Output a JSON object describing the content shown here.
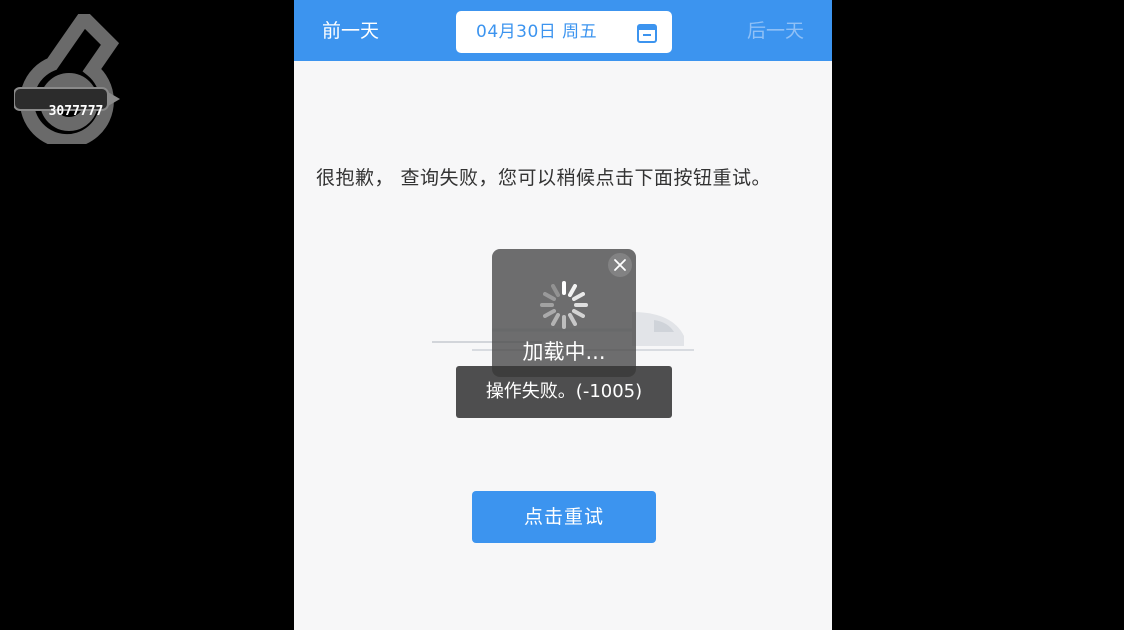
{
  "watermark": {
    "text": "3077777"
  },
  "header": {
    "prev_label": "前一天",
    "date_label": "04月30日 周五",
    "next_label": "后一天",
    "calendar_icon": "calendar-icon"
  },
  "main": {
    "message": "很抱歉， 查询失败，您可以稍候点击下面按钮重试。",
    "retry_label": "点击重试"
  },
  "loading": {
    "label": "加载中...",
    "close_icon": "close-icon"
  },
  "toast": {
    "text": "操作失败。(-1005)"
  },
  "colors": {
    "accent": "#3c94ef",
    "background": "#f7f7f8",
    "overlay": "#464646"
  }
}
